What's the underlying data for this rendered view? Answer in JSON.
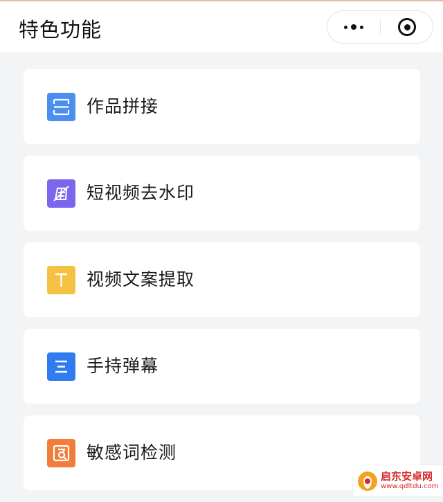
{
  "header": {
    "title": "特色功能",
    "more_icon": "more-dots-icon",
    "close_icon": "target-circle-icon"
  },
  "features": [
    {
      "label": "作品拼接",
      "icon": "splice-icon",
      "color": "#4a8ef0"
    },
    {
      "label": "短视频去水印",
      "icon": "remove-watermark-icon",
      "color": "#7b67ee"
    },
    {
      "label": "视频文案提取",
      "icon": "text-t-icon",
      "color": "#f5c143"
    },
    {
      "label": "手持弹幕",
      "icon": "lines-icon",
      "color": "#2f7bf0"
    },
    {
      "label": "敏感词检测",
      "icon": "sensitive-check-icon",
      "color": "#f27d3a"
    }
  ],
  "watermark": {
    "name": "启东安卓网",
    "url": "www.qdltdu.com",
    "accent": "#d7282a"
  }
}
